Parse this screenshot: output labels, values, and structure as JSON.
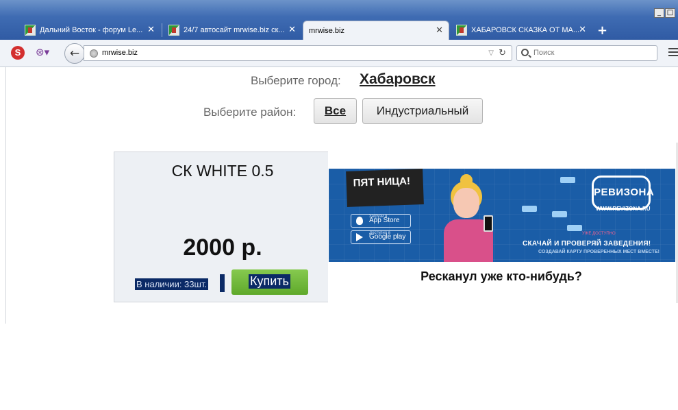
{
  "browser": {
    "tabs": [
      {
        "title": "Дальний Восток - форум Le...",
        "active": false
      },
      {
        "title": "24/7 автосайт mrwise.biz ск...",
        "active": false
      },
      {
        "title": "mrwise.biz",
        "active": true
      },
      {
        "title": "ХАБАРОВСК СКАЗКА ОТ МА...",
        "active": false
      }
    ],
    "new_tab_label": "+",
    "close_glyph": "✕",
    "window_controls": {
      "minimize": "_",
      "maximize": "□"
    },
    "url": "mrwise.biz",
    "search_placeholder": "Поиск",
    "back_glyph": "←",
    "reload_glyph": "↻",
    "dropdown_glyph": "▽"
  },
  "page": {
    "city_label": "Выберите город:",
    "city_value": "Хабаровск",
    "district_label": "Выберите район:",
    "district_buttons": [
      {
        "label": "Все",
        "selected": true
      },
      {
        "label": "Индустриальный",
        "selected": false
      }
    ],
    "product": {
      "name": "СК WHITE 0.5",
      "price": "2000 р.",
      "stock": "В наличии: 33шт.",
      "buy_label": "Купить"
    },
    "banner": {
      "pyatnica_logo": "ПЯТ НИЦА!",
      "app_store_caption": "Загрузи в",
      "app_store": "App Store",
      "google_play_caption": "Доступно в",
      "google_play": "Google play",
      "revizona_logo": "РЕВИЗОНА",
      "revizona_url": "WWW.REVIZONA.RU",
      "slogan_small": "УЖЕ ДОСТУПНО",
      "slogan": "СКАЧАЙ И ПРОВЕРЯЙ ЗАВЕДЕНИЯ!",
      "slogan_sub": "СОЗДАВАЙ КАРТУ ПРОВЕРЕННЫХ МЕСТ ВМЕСТЕ!",
      "caption": "Ресканул уже кто-нибудь?"
    }
  },
  "colors": {
    "tabstrip": "#3f6cb3",
    "buy_button": "#6fb83b",
    "selection": "#0b2a66",
    "banner_bg": "#1a5da7"
  }
}
